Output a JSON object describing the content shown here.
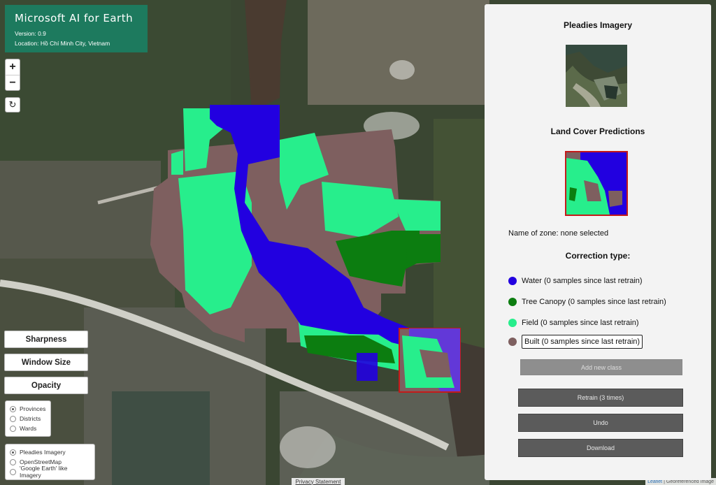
{
  "app": {
    "title": "Microsoft AI for Earth",
    "version": "Version: 0.9",
    "location": "Location: Hồ Chí Minh City, Vietnam"
  },
  "map_controls": {
    "zoom_in": "+",
    "zoom_out": "−",
    "reset": "↻"
  },
  "left_buttons": {
    "sharpness": "Sharpness",
    "window_size": "Window Size",
    "opacity": "Opacity"
  },
  "boundary_layers": {
    "options": [
      {
        "label": "Provinces",
        "selected": true
      },
      {
        "label": "Districts",
        "selected": false
      },
      {
        "label": "Wards",
        "selected": false
      }
    ]
  },
  "basemaps": {
    "options": [
      {
        "label": "Pleadies Imagery",
        "selected": true
      },
      {
        "label": "OpenStreetMap",
        "selected": false
      },
      {
        "label": "'Google Earth' like Imagery",
        "selected": false
      }
    ]
  },
  "footer": {
    "privacy": "Privacy Statement",
    "leaflet": "Leaflet",
    "attribution": "| Georeferenced Image"
  },
  "panel": {
    "imagery_heading": "Pleadies Imagery",
    "predictions_heading": "Land Cover Predictions",
    "zone_text": "Name of zone: none selected",
    "correction_heading": "Correction type:",
    "classes": [
      {
        "label": "Water (0 samples since last retrain)",
        "color": "#2200e0",
        "selected": false
      },
      {
        "label": "Tree Canopy (0 samples since last retrain)",
        "color": "#0c7d10",
        "selected": false
      },
      {
        "label": "Field (0 samples since last retrain)",
        "color": "#27ee8c",
        "selected": false
      },
      {
        "label": "Built (0 samples since last retrain)",
        "color": "#7e5f5f",
        "selected": true
      }
    ],
    "add_class": "Add new class",
    "retrain": "Retrain (3 times)",
    "undo": "Undo",
    "download": "Download"
  },
  "colors": {
    "water": "#2200e0",
    "tree_canopy": "#0c7d10",
    "field": "#27ee8c",
    "built": "#7e5f5f",
    "header": "#1d7a5e",
    "selection": "#c41a1a"
  }
}
